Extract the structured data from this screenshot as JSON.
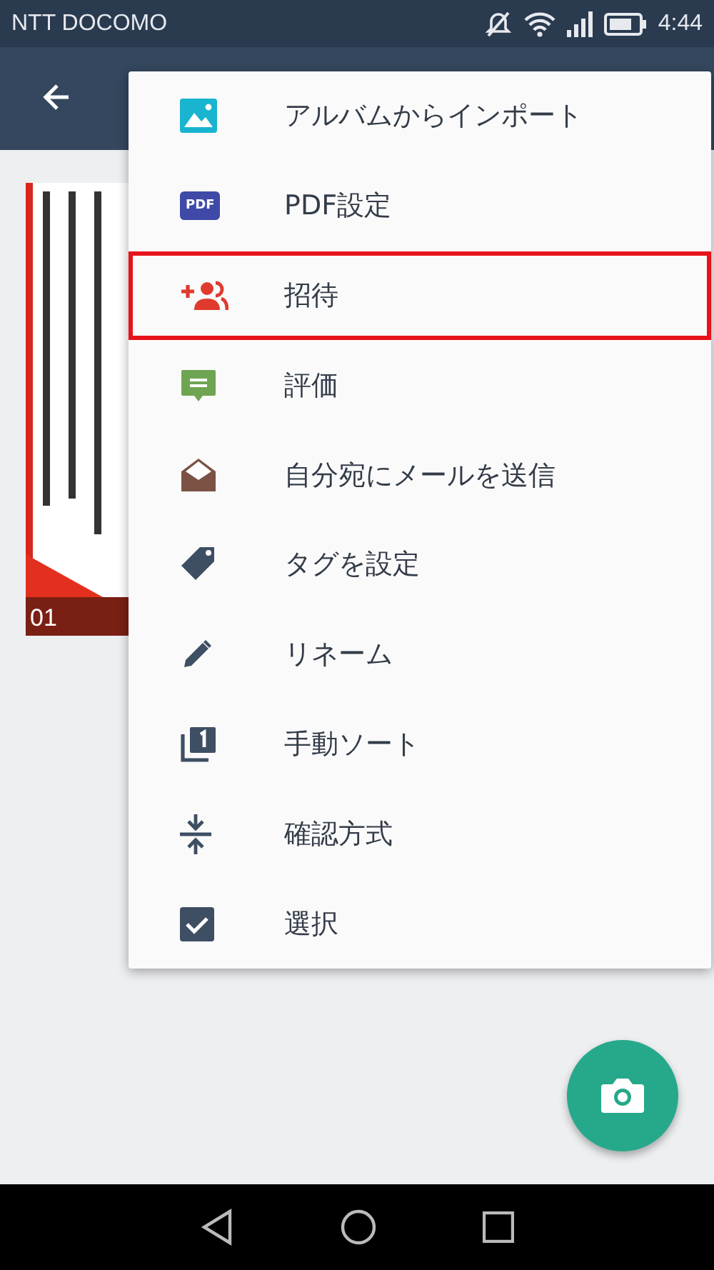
{
  "status_bar": {
    "carrier": "NTT DOCOMO",
    "time": "4:44"
  },
  "documents": [
    {
      "number": "01",
      "kind": "picture"
    }
  ],
  "menu": {
    "items": [
      {
        "label": "アルバムからインポート",
        "kind": "album",
        "highlighted": false
      },
      {
        "label": "PDF設定",
        "kind": "pdf",
        "icon_text": "PDF",
        "highlighted": false
      },
      {
        "label": "招待",
        "kind": "invite",
        "highlighted": true
      },
      {
        "label": "評価",
        "kind": "rate",
        "highlighted": false
      },
      {
        "label": "自分宛にメールを送信",
        "kind": "mail",
        "highlighted": false
      },
      {
        "label": "タグを設定",
        "kind": "tag",
        "highlighted": false
      },
      {
        "label": "リネーム",
        "kind": "rename",
        "highlighted": false
      },
      {
        "label": "手動ソート",
        "kind": "sort",
        "highlighted": false
      },
      {
        "label": "確認方式",
        "kind": "compress",
        "highlighted": false
      },
      {
        "label": "選択",
        "kind": "select",
        "highlighted": false
      }
    ]
  }
}
